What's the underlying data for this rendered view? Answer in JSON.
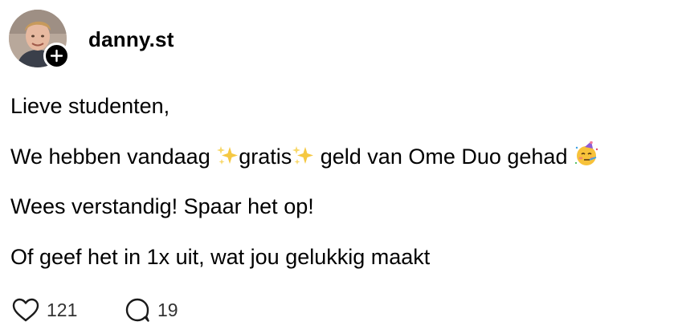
{
  "post": {
    "author": {
      "username": "danny.st",
      "avatar_icon": "profile-photo",
      "follow_icon": "plus-icon"
    },
    "lines": {
      "greeting": "Lieve studenten,",
      "line2_part1": "We hebben vandaag ",
      "line2_emoji1": "sparkles",
      "line2_word": "gratis",
      "line2_emoji2": "sparkles",
      "line2_part2": " geld van Ome Duo gehad ",
      "line2_emoji3": "partying-face",
      "line3": "Wees verstandig! Spaar het op!",
      "line4": "Of geef het in 1x uit, wat jou gelukkig maakt"
    },
    "actions": {
      "like_icon": "heart-icon",
      "like_count": "121",
      "reply_icon": "comment-icon",
      "reply_count": "19"
    }
  },
  "colors": {
    "text": "#000000",
    "muted_text": "#333333",
    "badge": "#000000",
    "sparkle": "#f5c842",
    "party_face": "#f7c23a"
  }
}
